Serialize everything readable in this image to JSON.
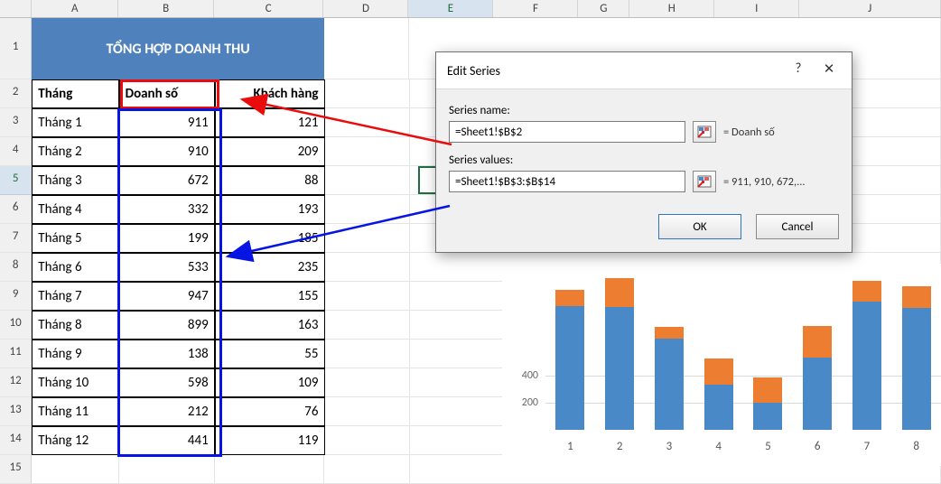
{
  "columns": [
    "A",
    "B",
    "C",
    "D",
    "E",
    "F",
    "G",
    "H",
    "I",
    "J"
  ],
  "title_band": "TỔNG HỢP DOANH THU",
  "headers": {
    "thang": "Tháng",
    "doanhso": "Doanh số",
    "khachhang": "Khách hàng"
  },
  "rows": [
    {
      "thang": "Tháng 1",
      "doanhso": "911",
      "khach": "121"
    },
    {
      "thang": "Tháng 2",
      "doanhso": "910",
      "khach": "209"
    },
    {
      "thang": "Tháng 3",
      "doanhso": "672",
      "khach": "88"
    },
    {
      "thang": "Tháng 4",
      "doanhso": "332",
      "khach": "193"
    },
    {
      "thang": "Tháng 5",
      "doanhso": "199",
      "khach": "185"
    },
    {
      "thang": "Tháng 6",
      "doanhso": "533",
      "khach": "235"
    },
    {
      "thang": "Tháng 7",
      "doanhso": "947",
      "khach": "155"
    },
    {
      "thang": "Tháng 8",
      "doanhso": "899",
      "khach": "163"
    },
    {
      "thang": "Tháng 9",
      "doanhso": "138",
      "khach": "55"
    },
    {
      "thang": "Tháng 10",
      "doanhso": "598",
      "khach": "109"
    },
    {
      "thang": "Tháng 11",
      "doanhso": "212",
      "khach": "76"
    },
    {
      "thang": "Tháng 12",
      "doanhso": "441",
      "khach": "119"
    }
  ],
  "dialog": {
    "title": "Edit Series",
    "help": "?",
    "close": "✕",
    "series_name_label": "Series name:",
    "series_name_value": "=Sheet1!$B$2",
    "series_name_preview": "= Doanh số",
    "series_values_label": "Series values:",
    "series_values_value": "=Sheet1!$B$3:$B$14",
    "series_values_preview": "= 911, 910, 672,...",
    "ok": "OK",
    "cancel": "Cancel"
  },
  "chart_data": {
    "type": "bar",
    "stacked": true,
    "categories": [
      "1",
      "2",
      "3",
      "4",
      "5",
      "6",
      "7",
      "8"
    ],
    "series": [
      {
        "name": "Doanh số",
        "color": "#4a89c7",
        "values": [
          911,
          910,
          672,
          332,
          199,
          533,
          947,
          899
        ]
      },
      {
        "name": "Khách hàng",
        "color": "#ed7d31",
        "values": [
          121,
          209,
          88,
          193,
          185,
          235,
          155,
          163
        ]
      }
    ],
    "y_ticks": [
      200,
      400
    ],
    "ymax": 1200,
    "title": "",
    "xlabel": "",
    "ylabel": ""
  }
}
